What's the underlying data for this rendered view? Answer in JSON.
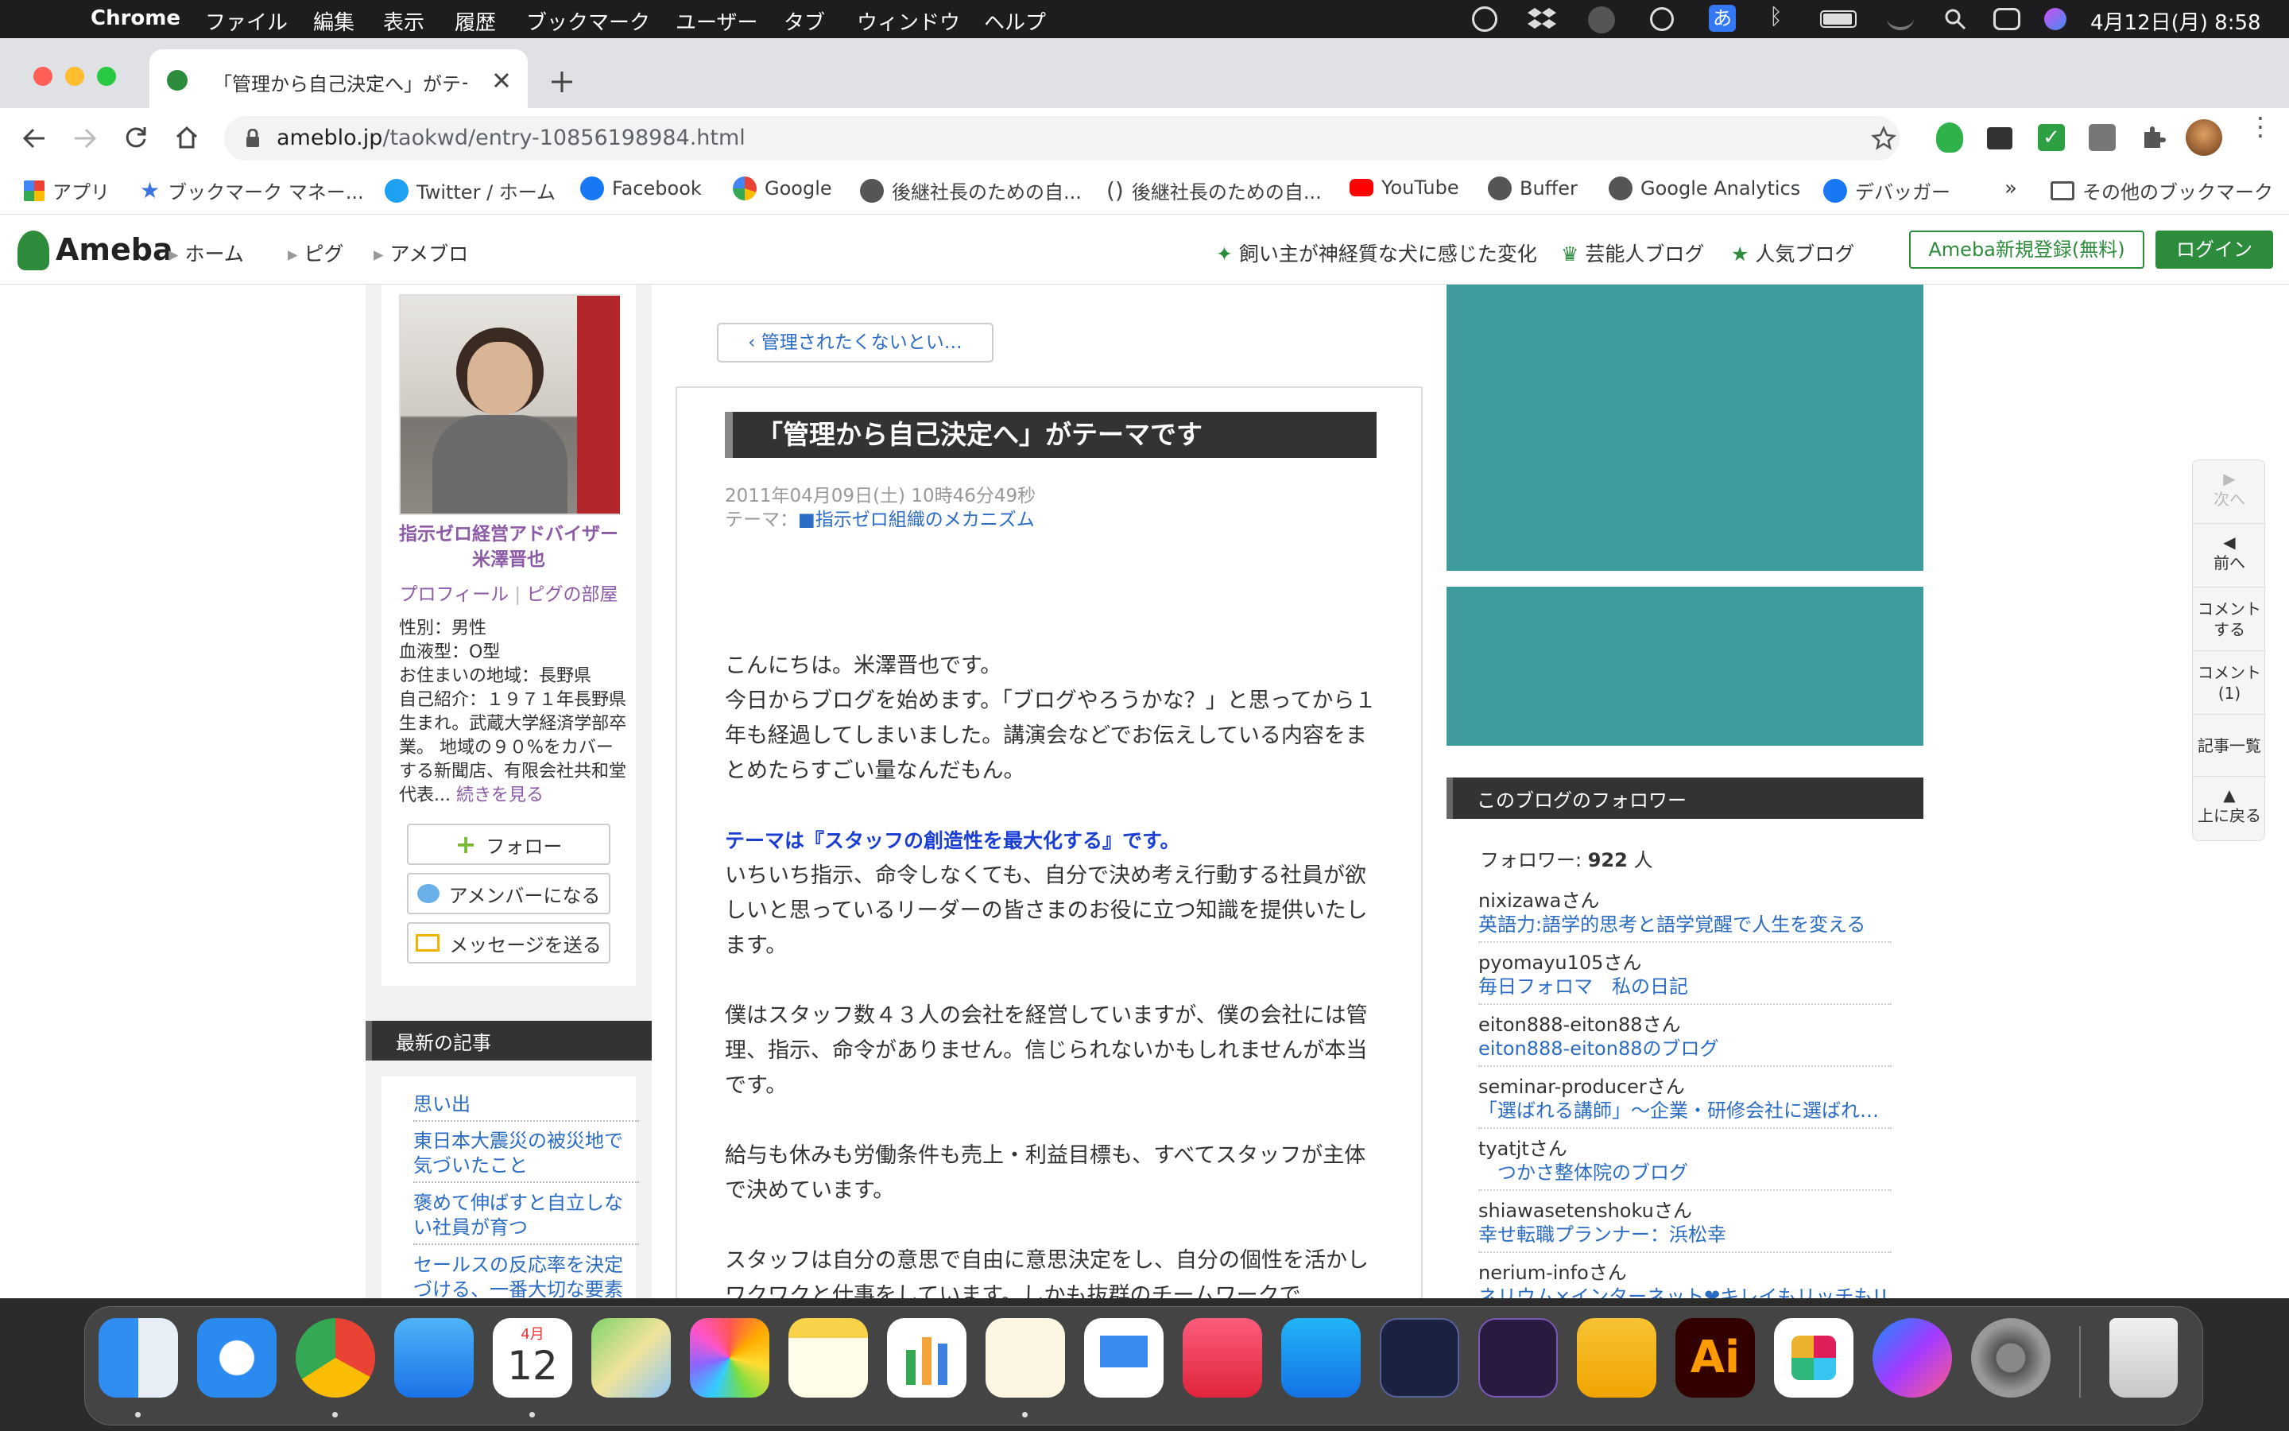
{
  "menubar": {
    "app": "Chrome",
    "items": [
      "ファイル",
      "編集",
      "表示",
      "履歴",
      "ブックマーク",
      "ユーザー",
      "タブ",
      "ウィンドウ",
      "ヘルプ"
    ],
    "ime": "あ",
    "clock": "4月12日(月)  8:58"
  },
  "tab": {
    "title": "「管理から自己決定へ」がテーマで"
  },
  "omnibox": {
    "host": "ameblo.jp",
    "path": "/taokwd/entry-10856198984.html"
  },
  "bookmarks": {
    "items": [
      "アプリ",
      "ブックマーク マネー...",
      "Twitter / ホーム",
      "Facebook",
      "Google",
      "後継社長のための自...",
      "後継社長のための自...",
      "YouTube",
      "Buffer",
      "Google Analytics",
      "デバッガー"
    ],
    "more": "»",
    "other": "その他のブックマーク"
  },
  "ameba": {
    "logo": "Ameba",
    "nav": [
      "ホーム",
      "ピグ",
      "アメブロ"
    ],
    "topics": [
      "飼い主が神経質な犬に感じた変化",
      "芸能人ブログ",
      "人気ブログ"
    ],
    "register": "Ameba新規登録(無料)",
    "login": "ログイン"
  },
  "profile": {
    "name": "指示ゼロ経営アドバイザー　米澤晋也",
    "links": [
      "プロフィール",
      "ピグの部屋"
    ],
    "sep": "|",
    "details": [
      "性別：男性",
      "血液型：O型",
      "お住まいの地域：長野県"
    ],
    "intro": "自己紹介：１９７１年長野県生まれ。武蔵大学経済学部卒業。 地域の９０%をカバーする新聞店、有限会社共和堂　代表...",
    "more": "続きを見る",
    "follow": "フォロー",
    "amember": "アメンバーになる",
    "message": "メッセージを送る"
  },
  "recent": {
    "heading": "最新の記事",
    "items": [
      "思い出",
      "東日本大震災の被災地で気づいたこと",
      "褒めて伸ばすと自立しない社員が育つ",
      "セールスの反応率を決定づける、一番大切な要素"
    ]
  },
  "article": {
    "prev": "管理されたくないとい…",
    "title": "「管理から自己決定へ」がテーマです",
    "date": "2011年04月09日(土) 10時46分49秒",
    "theme_label": "テーマ：",
    "theme": "■指示ゼロ組織のメカニズム",
    "p1": "こんにちは。米澤晋也です。",
    "p2": "今日からブログを始めます。「ブログやろうかな？」と思ってから１年も経過してしまいました。講演会などでお伝えしている内容をまとめたらすごい量なんだもん。",
    "highlight": "テーマは『スタッフの創造性を最大化する』です。",
    "p3": "いちいち指示、命令しなくても、自分で決め考え行動する社員が欲しいと思っているリーダーの皆さまのお役に立つ知識を提供いたします。",
    "p4": "僕はスタッフ数４３人の会社を経営していますが、僕の会社には管理、指示、命令がありません。信じられないかもしれませんが本当です。",
    "p5": "給与も休みも労働条件も売上・利益目標も、すべてスタッフが主体で決めています。",
    "p6": "スタッフは自分の意思で自由に意思決定をし、自分の個性を活かしワクワクと仕事をしています。しかも抜群のチームワークで"
  },
  "followers": {
    "heading": "このブログのフォロワー",
    "count_label": "フォロワー: ",
    "count": "922",
    "unit": " 人",
    "items": [
      {
        "name": "nixizawaさん",
        "blog": "英語力:語学的思考と語学覚醒で人生を変える"
      },
      {
        "name": "pyomayu105さん",
        "blog": "毎日フォロマ　私の日記"
      },
      {
        "name": "eiton888-eiton88さん",
        "blog": "eiton888-eiton88のブログ"
      },
      {
        "name": "seminar-producerさん",
        "blog": "「選ばれる講師」～企業・研修会社に選ばれ…"
      },
      {
        "name": "tyatjtさん",
        "blog": "　つかさ整体院のブログ"
      },
      {
        "name": "shiawasetenshokuさん",
        "blog": "幸せ転職プランナー：浜松幸"
      },
      {
        "name": "nerium-infoさん",
        "blog": "ネリウム×インターネット❤キレイもリッチも!!"
      }
    ]
  },
  "sidenav": {
    "next": "次へ",
    "prev": "前へ",
    "comment": "コメント\nする",
    "comments": "コメント\n(1)",
    "list": "記事一覧",
    "top": "上に戻る"
  },
  "dock": {
    "calendar_month": "4月",
    "calendar_day": "12",
    "ai": "Ai"
  },
  "colors": {
    "teal": "#409c9c",
    "ameba_green": "#2d8c3c",
    "link": "#2b6cc4",
    "profile_purple": "#8c5aa6"
  }
}
